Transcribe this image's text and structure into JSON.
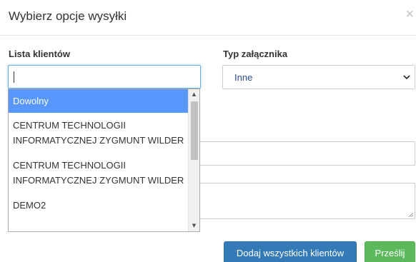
{
  "modal": {
    "title": "Wybierz opcje wysyłki",
    "close_glyph": "×"
  },
  "clients": {
    "label": "Lista klientów",
    "input_value": "",
    "options": [
      "Dowolny",
      "CENTRUM TECHNOLOGII INFORMATYCZNEJ ZYGMUNT WILDER",
      "CENTRUM TECHNOLOGII INFORMATYCZNEJ ZYGMUNT WILDER",
      "DEMO2"
    ],
    "highlighted_option": "Dowolny"
  },
  "attachment": {
    "label": "Typ załącznika",
    "selected": "Inne"
  },
  "buttons": {
    "add_all": "Dodaj wszystkich klientów",
    "send": "Prześlij"
  },
  "colors": {
    "highlight": "#5897fb",
    "primary_button": "#337ab7",
    "success_button": "#5cb85c",
    "focus_border": "#66afe9"
  }
}
